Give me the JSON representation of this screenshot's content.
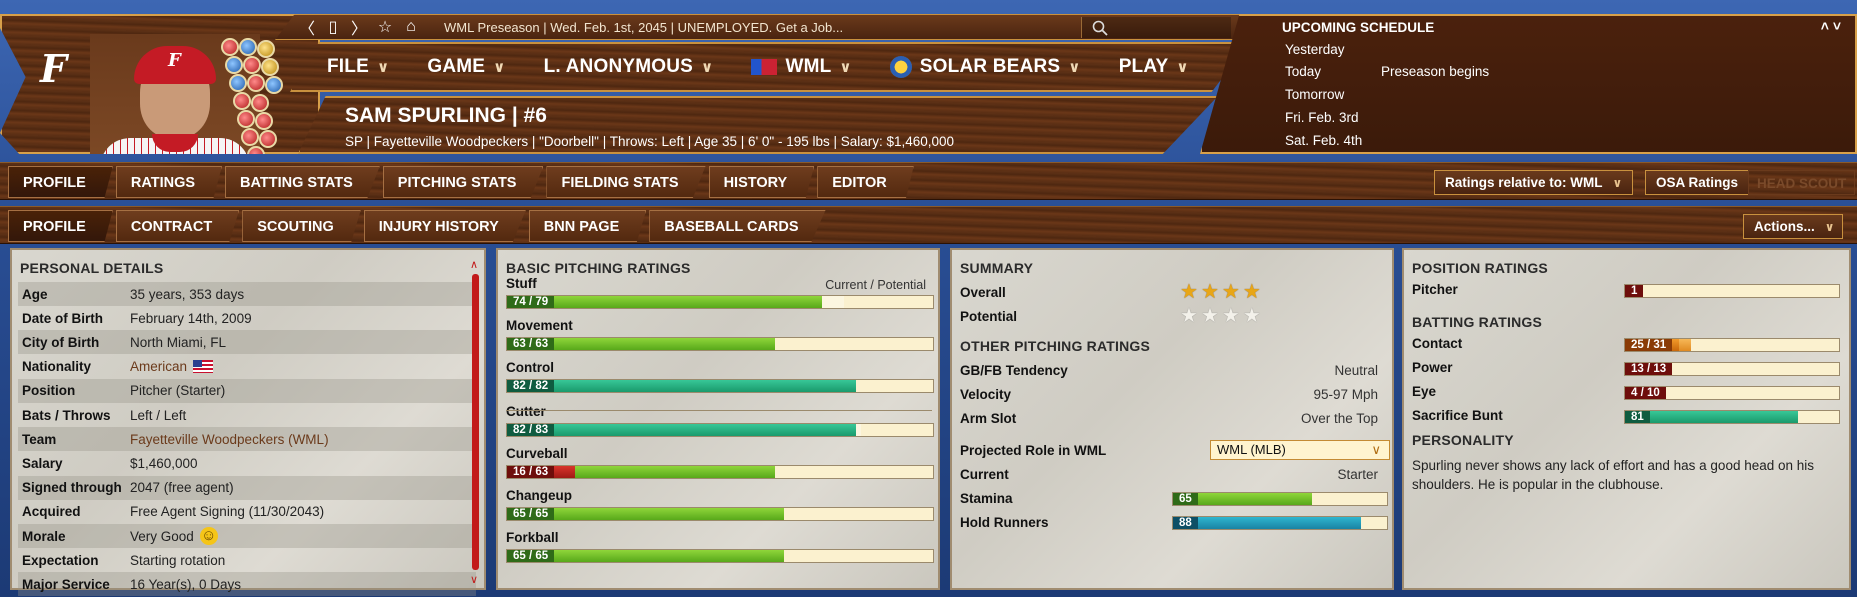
{
  "header": {
    "status_text": "WML Preseason  |  Wed. Feb. 1st, 2045  |  UNEMPLOYED. Get a Job...",
    "menu": [
      {
        "label": "FILE"
      },
      {
        "label": "GAME"
      },
      {
        "label": "L. ANONYMOUS"
      },
      {
        "label": "WML"
      },
      {
        "label": "SOLAR BEARS"
      },
      {
        "label": "PLAY"
      }
    ],
    "player_name": "SAM SPURLING  |  #6",
    "player_info": "SP | Fayetteville Woodpeckers  |  \"Doorbell\" | Throws: Left  |  Age 35  |  6' 0\" - 195 lbs  |  Salary: $1,460,000",
    "logo_letter": "F"
  },
  "schedule": {
    "title": "UPCOMING SCHEDULE",
    "toggle": "˄ ˅",
    "rows": [
      {
        "day": "Yesterday",
        "event": ""
      },
      {
        "day": "Today",
        "event": "Preseason begins"
      },
      {
        "day": "Tomorrow",
        "event": ""
      },
      {
        "day": "Fri. Feb. 3rd",
        "event": ""
      },
      {
        "day": "Sat. Feb. 4th",
        "event": ""
      }
    ]
  },
  "tabs_primary": [
    "PROFILE",
    "RATINGS",
    "BATTING STATS",
    "PITCHING STATS",
    "FIELDING STATS",
    "HISTORY",
    "EDITOR"
  ],
  "tabs_secondary": [
    "PROFILE",
    "CONTRACT",
    "SCOUTING",
    "INJURY HISTORY",
    "BNN PAGE",
    "BASEBALL CARDS"
  ],
  "controls": {
    "ratings_relative": "Ratings relative to: WML",
    "osa_ratings": "OSA Ratings",
    "head_scout": "HEAD SCOUT",
    "actions": "Actions..."
  },
  "personal": {
    "title": "PERSONAL DETAILS",
    "rows": [
      {
        "label": "Age",
        "value": "35 years, 353 days"
      },
      {
        "label": "Date of Birth",
        "value": "February 14th, 2009"
      },
      {
        "label": "City of Birth",
        "value": "North Miami, FL"
      },
      {
        "label": "Nationality",
        "value": "American"
      },
      {
        "label": "Position",
        "value": "Pitcher (Starter)"
      },
      {
        "label": "Bats / Throws",
        "value": "Left / Left"
      },
      {
        "label": "Team",
        "value": "Fayetteville Woodpeckers (WML)"
      },
      {
        "label": "Salary",
        "value": "$1,460,000"
      },
      {
        "label": "Signed through",
        "value": "2047 (free agent)"
      },
      {
        "label": "Acquired",
        "value": "Free Agent Signing (11/30/2043)"
      },
      {
        "label": "Morale",
        "value": "Very Good"
      },
      {
        "label": "Expectation",
        "value": "Starting rotation"
      },
      {
        "label": "Major Service",
        "value": "16 Year(s), 0 Days"
      }
    ]
  },
  "pitching": {
    "title": "BASIC PITCHING RATINGS",
    "legend": "Current / Potential",
    "ratings": [
      {
        "name": "Stuff",
        "label": "74 / 79",
        "current": 74,
        "potential": 79,
        "color": "green"
      },
      {
        "name": "Movement",
        "label": "63 / 63",
        "current": 63,
        "potential": 63,
        "color": "green"
      },
      {
        "name": "Control",
        "label": "82 / 82",
        "current": 82,
        "potential": 82,
        "color": "teal"
      },
      {
        "name": "Cutter",
        "label": "82 / 83",
        "current": 82,
        "potential": 83,
        "color": "teal"
      },
      {
        "name": "Curveball",
        "label": "16 / 63",
        "current": 16,
        "potential": 63,
        "color": "red"
      },
      {
        "name": "Changeup",
        "label": "65 / 65",
        "current": 65,
        "potential": 65,
        "color": "green"
      },
      {
        "name": "Forkball",
        "label": "65 / 65",
        "current": 65,
        "potential": 65,
        "color": "green"
      }
    ]
  },
  "summary": {
    "title": "SUMMARY",
    "overall_label": "Overall",
    "overall_stars": 4,
    "potential_label": "Potential",
    "potential_stars": 0,
    "other_title": "OTHER PITCHING RATINGS",
    "other": [
      {
        "label": "GB/FB Tendency",
        "value": "Neutral"
      },
      {
        "label": "Velocity",
        "value": "95-97 Mph"
      },
      {
        "label": "Arm Slot",
        "value": "Over the Top"
      }
    ],
    "projected_label": "Projected Role in WML",
    "projected_value": "WML (MLB)",
    "current_label": "Current",
    "current_value": "Starter",
    "stamina_label": "Stamina",
    "stamina_value": "65",
    "stamina": 65,
    "hold_label": "Hold Runners",
    "hold_value": "88",
    "hold": 88
  },
  "position": {
    "title": "POSITION RATINGS",
    "ratings": [
      {
        "name": "Pitcher",
        "label": "1",
        "current": 1,
        "potential": 1,
        "color": "red"
      }
    ],
    "batting_title": "BATTING RATINGS",
    "batting": [
      {
        "name": "Contact",
        "label": "25 / 31",
        "current": 25,
        "potential": 31,
        "color": "orange"
      },
      {
        "name": "Power",
        "label": "13 / 13",
        "current": 13,
        "potential": 13,
        "color": "red"
      },
      {
        "name": "Eye",
        "label": "4 / 10",
        "current": 4,
        "potential": 10,
        "color": "red"
      },
      {
        "name": "Sacrifice Bunt",
        "label": "81",
        "current": 81,
        "potential": 81,
        "color": "teal"
      }
    ],
    "personality_title": "PERSONALITY",
    "personality_text": "Spurling never shows any lack of effort and has a good head on his shoulders. He is popular in the clubhouse."
  }
}
